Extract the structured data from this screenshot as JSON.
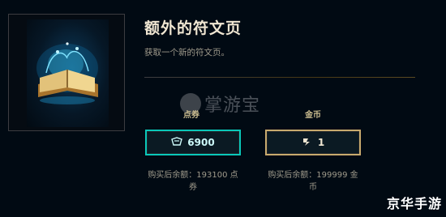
{
  "item": {
    "title": "额外的符文页",
    "description": "获取一个新的符文页。"
  },
  "currencies": {
    "rp_label": "点券",
    "be_label": "金币"
  },
  "buttons": {
    "rp_price": "6900",
    "be_price": "1",
    "rp_icon": "rp-coin-icon",
    "be_icon": "blue-essence-icon"
  },
  "balances": {
    "rp_after": "购买后余额：193100 点券",
    "be_after": "购买后余额：199999 金币"
  },
  "watermarks": {
    "center": "掌游宝",
    "corner": "京华手游"
  },
  "colors": {
    "background": "#010a13",
    "rp_border": "#0ac8b9",
    "be_border": "#c8aa6e",
    "title": "#f0e6d2"
  }
}
